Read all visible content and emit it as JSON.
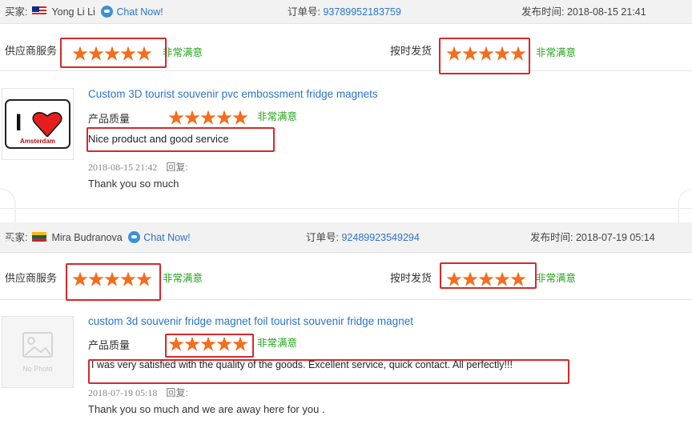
{
  "labels": {
    "buyer": "买家:",
    "order_no": "订单号:",
    "published": "发布时间:",
    "supplier_service": "供应商服务",
    "on_time_delivery": "按时发货",
    "product_quality": "产品质量",
    "reply": "回复:"
  },
  "reviews": [
    {
      "buyer_name": "Yong Li Li",
      "country_flag": "malaysia-flag-icon",
      "chat_label": "Chat Now!",
      "order_number": "93789952183759",
      "published_time": "2018-08-15 21:41",
      "supplier_service_stars": 5,
      "supplier_service_text": "非常满意",
      "on_time_stars": 5,
      "on_time_text": "非常满意",
      "product_title": "Custom 3D tourist souvenir pvc embossment fridge magnets",
      "product_image": "i-love-amsterdam-magnet-image",
      "image_text_1": "I",
      "image_text_2": "Amsterdam",
      "product_quality_stars": 5,
      "product_quality_text": "非常满意",
      "comment": "Nice product and good service",
      "comment_time": "2018-08-15 21:42",
      "reply_text": "Thank you so much"
    },
    {
      "buyer_name": "Mira Budranova",
      "country_flag": "lithuania-flag-icon",
      "chat_label": "Chat Now!",
      "order_number": "92489923549294",
      "published_time": "2018-07-19 05:14",
      "supplier_service_stars": 5,
      "supplier_service_text": "非常满意",
      "on_time_stars": 5,
      "on_time_text": "非常满意",
      "product_title": "custom 3d souvenir fridge magnet foil tourist souvenir fridge magnet",
      "product_image": "no-photo-placeholder-image",
      "no_photo_label": "No Photo",
      "product_quality_stars": 5,
      "product_quality_text": "非常满意",
      "comment": "I was very satisfied with the quality of the goods. Excellent service, quick contact. All perfectly!!!",
      "comment_time": "2018-07-19 05:18",
      "reply_text": "Thank you so much and we are away here for you ."
    }
  ],
  "colors": {
    "star": "#f46d1c",
    "satisfied": "#23a31c",
    "link": "#2a74c9",
    "highlight_box": "#d7282b",
    "header_bg": "#f2f2f2"
  }
}
